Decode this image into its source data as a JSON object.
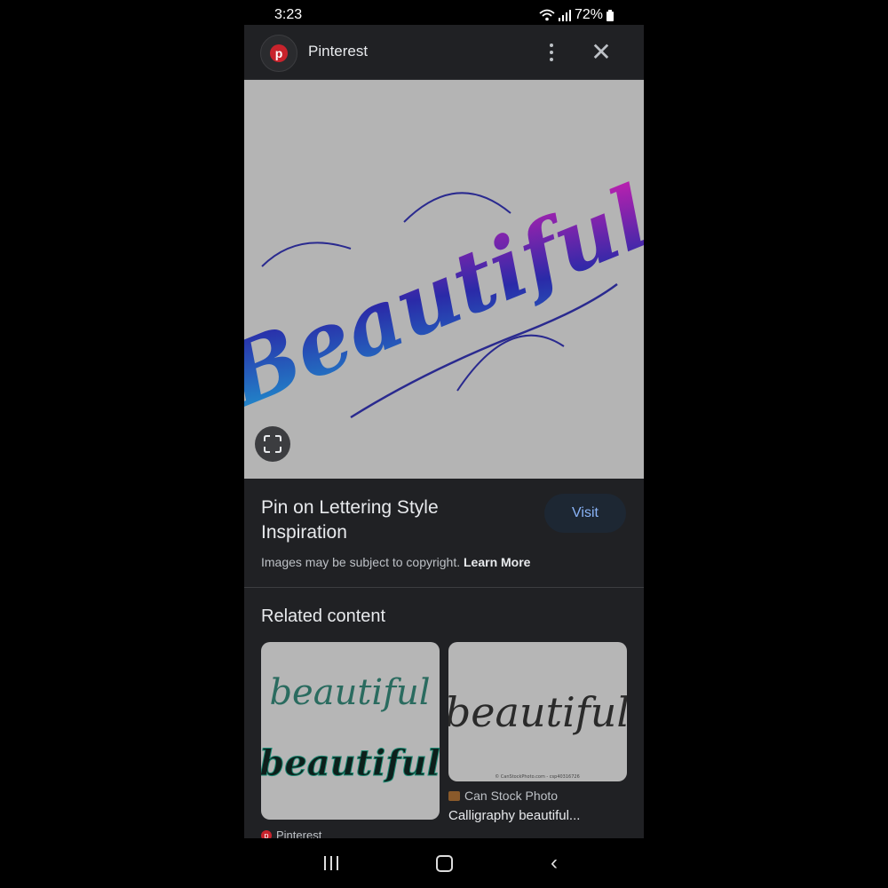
{
  "status_bar": {
    "time": "3:23",
    "battery": "72%"
  },
  "header": {
    "source_name": "Pinterest"
  },
  "hero": {
    "image_text": "Beautiful"
  },
  "result": {
    "title": "Pin on Lettering Style Inspiration",
    "visit_label": "Visit",
    "copyright_text": "Images may be subject to copyright.",
    "learn_more": "Learn More"
  },
  "related": {
    "heading": "Related content",
    "cards": [
      {
        "image_text_top": "beautiful",
        "image_text_bottom": "beautiful",
        "source": "Pinterest"
      },
      {
        "image_text": "beautiful",
        "watermark": "© CanStockPhoto.com - csp40316726",
        "source": "Can Stock Photo",
        "title": "Calligraphy beautiful..."
      }
    ]
  },
  "colors": {
    "background": "#202124",
    "accent": "#8ab4f8",
    "pinterest": "#c8232c"
  }
}
